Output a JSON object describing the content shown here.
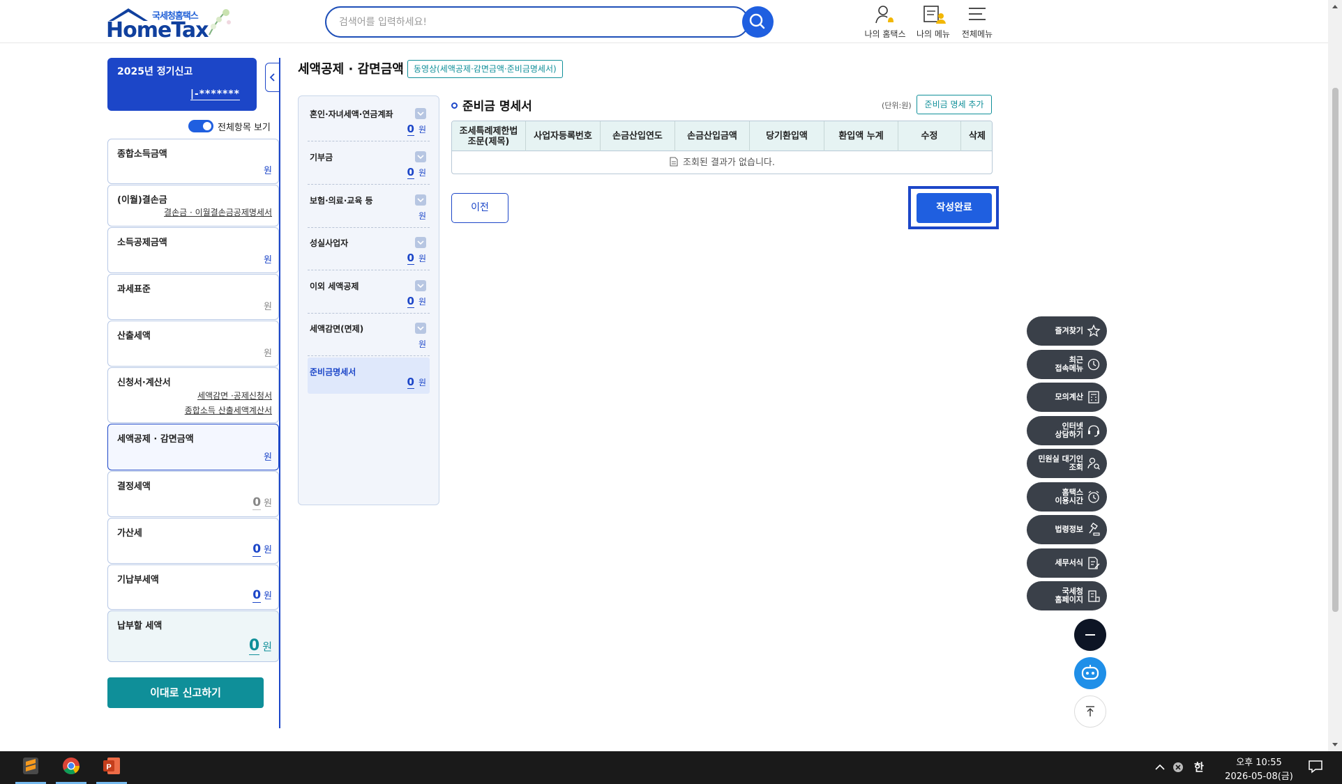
{
  "header": {
    "logo_small": "국세청홈택스",
    "logo_big": "HomeTax",
    "search_placeholder": "검색어를 입력하세요!",
    "menus": [
      {
        "label": "나의 홈택스",
        "icon": "person-bell-icon"
      },
      {
        "label": "나의 메뉴",
        "icon": "document-person-icon"
      },
      {
        "label": "전체메뉴",
        "icon": "hamburger-icon"
      }
    ]
  },
  "sidebar": {
    "filing_title": "2025년 정기신고",
    "filing_id": "|-*******",
    "toggle_label": "전체항목 보기",
    "items": [
      {
        "title": "종합소득금액",
        "unit": "원"
      },
      {
        "title": "(이월)결손금",
        "sub1": "결손금 · 이월결손금공제명세서"
      },
      {
        "title": "소득공제금액",
        "unit": "원"
      },
      {
        "title": "과세표준",
        "unit": "원"
      },
      {
        "title": "산출세액",
        "unit": "원"
      },
      {
        "title": "신청서·계산서",
        "sub1": "세액감면 ·공제신청서",
        "sub2": "종합소득 산출세액계산서"
      },
      {
        "title": "세액공제 · 감면금액",
        "unit": "원"
      },
      {
        "title": "결정세액",
        "value": "0",
        "unit": "원"
      },
      {
        "title": "가산세",
        "value": "0",
        "unit": "원"
      },
      {
        "title": "기납부세액",
        "value": "0",
        "unit": "원"
      },
      {
        "title": "납부할 세액",
        "value": "0",
        "unit": "원"
      }
    ],
    "report_button": "이대로 신고하기"
  },
  "main": {
    "page_title": "세액공제 · 감면금액",
    "video_tag": "동영상(세액공제·감면금액·준비금명세서)",
    "categories": [
      {
        "label": "혼인·자녀세액·연금계좌",
        "value": "0",
        "unit": "원"
      },
      {
        "label": "기부금",
        "value": "0",
        "unit": "원"
      },
      {
        "label": "보험·의료·교육 등",
        "value": "",
        "unit": "원"
      },
      {
        "label": "성실사업자",
        "value": "0",
        "unit": "원"
      },
      {
        "label": "이외 세액공제",
        "value": "0",
        "unit": "원"
      },
      {
        "label": "세액감면(면제)",
        "value": "",
        "unit": "원"
      },
      {
        "label": "준비금명세서",
        "value": "0",
        "unit": "원"
      }
    ],
    "section_title": "준비금 명세서",
    "unit_note": "(단위:원)",
    "add_button": "준비금 명세 추가",
    "table": {
      "headers": [
        "조세특례제한법\n조문(제목)",
        "사업자등록번호",
        "손금산입연도",
        "손금산입금액",
        "당기환입액",
        "환입액 누계",
        "수정",
        "삭제"
      ],
      "empty_message": "조회된 결과가 없습니다."
    },
    "prev_button": "이전",
    "done_button": "작성완료"
  },
  "quick_menu": [
    {
      "label": "즐겨찾기",
      "icon": "star-icon"
    },
    {
      "label": "최근\n접속메뉴",
      "icon": "clock-icon"
    },
    {
      "label": "모의계산",
      "icon": "calculator-icon"
    },
    {
      "label": "인터넷\n상담하기",
      "icon": "chat-headset-icon"
    },
    {
      "label": "민원실 대기인\n조회",
      "icon": "person-search-icon"
    },
    {
      "label": "홈택스\n이용시간",
      "icon": "alarm-clock-icon"
    },
    {
      "label": "법령정보",
      "icon": "gavel-icon"
    },
    {
      "label": "세무서식",
      "icon": "form-edit-icon"
    },
    {
      "label": "국세청\n홈페이지",
      "icon": "building-link-icon"
    }
  ],
  "taskbar": {
    "apps": [
      "sublime-text-icon",
      "chrome-icon",
      "powerpoint-icon"
    ],
    "ime": "한",
    "time": "오후 10:55",
    "date": "2026-05-08(금)"
  },
  "colors": {
    "primary": "#1c46c8",
    "button_blue": "#1f5fe0",
    "teal": "#0f8f99",
    "quick_menu": "#3a4049"
  }
}
